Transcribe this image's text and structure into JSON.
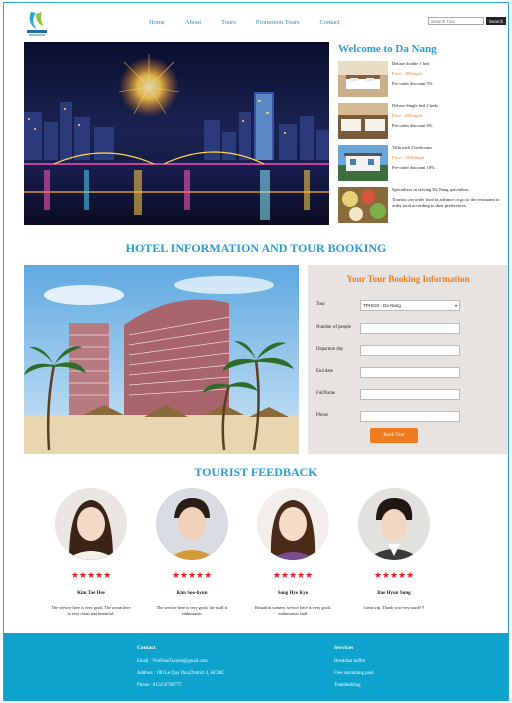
{
  "header": {
    "nav": [
      "Home",
      "About",
      "Tours",
      "Promotion Tours",
      "Contact"
    ],
    "search_placeholder": "Search Tour",
    "search_button": "Search"
  },
  "welcome": {
    "title": "Welcome to Da Nang",
    "rooms": [
      {
        "title": "Deluxe double 1 bed",
        "price": "Price : 30$/night",
        "discount": "Pre-order discount 5%"
      },
      {
        "title": "Deluxe Single bed 2 beds",
        "price": "Price : 45$/night",
        "discount": "Pre-order discount 8%"
      },
      {
        "title": "Villa with 3 bedrooms",
        "price": "Price : 100$/night",
        "discount": "Pre-order discount 10%"
      }
    ],
    "special": {
      "line1": "Specializes in serving Da Nang specialties.",
      "line2": "Tourists can order food in advance or go to the restaurant to order food according to their preferences."
    }
  },
  "section1_title": "HOTEL INFORMATION AND TOUR BOOKING",
  "booking": {
    "title": "Your Tour Booking Information",
    "fields": [
      {
        "label": "Tour",
        "value": "TPHCM - Da Nang"
      },
      {
        "label": "Number of people",
        "value": ""
      },
      {
        "label": "Departure day",
        "value": ""
      },
      {
        "label": "End date",
        "value": ""
      },
      {
        "label": "FullName",
        "value": ""
      },
      {
        "label": "Phone",
        "value": ""
      }
    ],
    "button": "Book Tour"
  },
  "section2_title": "TOURIST FEEDBACK",
  "feedback": [
    {
      "name": "Kim Tae Hee",
      "stars": "★★★★★",
      "message": "The service here is very good. The ocean here is very clean and beautiful."
    },
    {
      "name": "Kim Soo-hyun",
      "stars": "★★★★★",
      "message": "The service here is very good, the staff is enthusiastic"
    },
    {
      "name": "Song Hye Kyo",
      "stars": "★★★★★",
      "message": "Beautiful scenery, service here is very good, enthusiastic staff"
    },
    {
      "name": "Bae Hyun Sung",
      "stars": "★★★★★",
      "message": "Great trip. Thank you very much!!!"
    }
  ],
  "footer": {
    "contact_title": "Contact",
    "email": "Email : VietNamTourist@gmail.com",
    "address": "Address : 180 Le Quy Don,District 3, HCMC",
    "phone": "Phone : 012456789777",
    "services_title": "Services",
    "services": [
      "Breakfast buffet",
      "Free swimming pool",
      "Teambuilding"
    ]
  },
  "colors": {
    "accent": "#2a9bd3",
    "orange": "#f07b1f",
    "footer": "#0ea3cc",
    "star": "#e81d24"
  }
}
